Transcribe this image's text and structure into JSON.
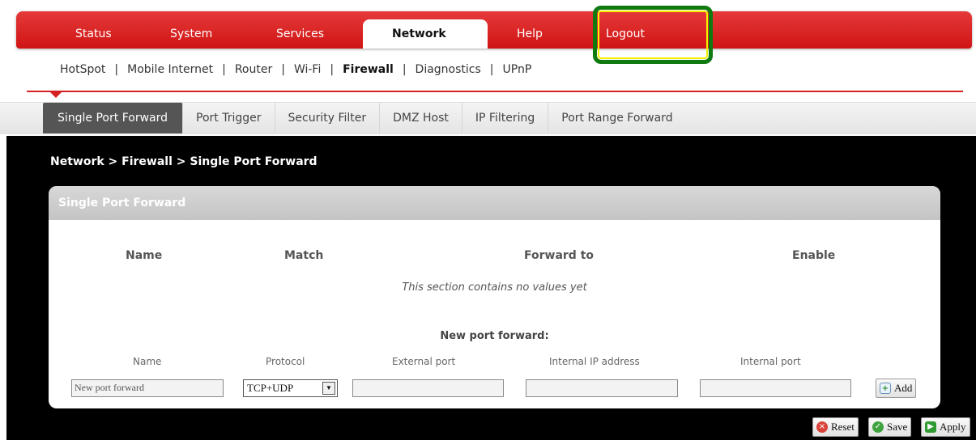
{
  "top_tabs": [
    {
      "label": "Status"
    },
    {
      "label": "System"
    },
    {
      "label": "Services"
    },
    {
      "label": "Network"
    },
    {
      "label": "Help"
    },
    {
      "label": "Logout"
    }
  ],
  "sub_nav": [
    "HotSpot",
    "Mobile Internet",
    "Router",
    "Wi-Fi",
    "Firewall",
    "Diagnostics",
    "UPnP"
  ],
  "third_nav": [
    "Single Port Forward",
    "Port Trigger",
    "Security Filter",
    "DMZ Host",
    "IP Filtering",
    "Port Range Forward"
  ],
  "breadcrumb": "Network > Firewall > Single Port Forward",
  "panel": {
    "title": "Single Port Forward",
    "columns": [
      "Name",
      "Match",
      "Forward to",
      "Enable"
    ],
    "empty_message": "This section contains no values yet",
    "new_title": "New port forward:",
    "new_columns": [
      "Name",
      "Protocol",
      "External port",
      "Internal IP address",
      "Internal port"
    ],
    "name_placeholder": "New port forward",
    "protocol_value": "TCP+UDP",
    "add_label": "Add"
  },
  "footer": {
    "reset": "Reset",
    "save": "Save",
    "apply": "Apply"
  },
  "colors": {
    "brand_red": "#d01414",
    "highlight_green": "#0f7a10",
    "highlight_yellow": "#f4f000"
  }
}
